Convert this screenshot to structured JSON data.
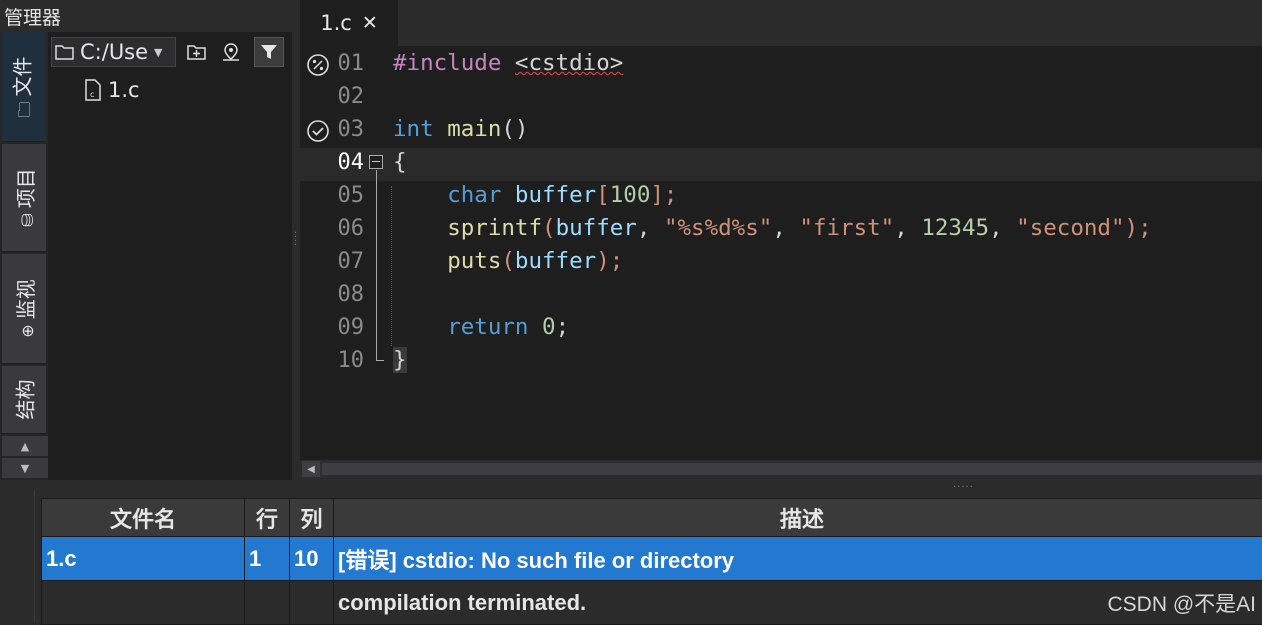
{
  "manager": {
    "title": "管理器",
    "side_tabs": [
      "文件",
      "项目",
      "监视",
      "结构"
    ],
    "path": "C:/Use",
    "tree": [
      {
        "name": "1.c"
      }
    ]
  },
  "editor": {
    "tabs": [
      {
        "label": "1.c",
        "close": "✕"
      }
    ],
    "current_line": "04",
    "lines": [
      {
        "n": "01",
        "icon": "breakpoint-percent"
      },
      {
        "n": "02"
      },
      {
        "n": "03",
        "icon": "check"
      },
      {
        "n": "04"
      },
      {
        "n": "05"
      },
      {
        "n": "06"
      },
      {
        "n": "07"
      },
      {
        "n": "08"
      },
      {
        "n": "09"
      },
      {
        "n": "10"
      }
    ],
    "code": {
      "l1_directive": "#include",
      "l1_header": "<cstdio>",
      "l3_type": "int",
      "l3_name": "main",
      "l3_parens": "()",
      "l4": "{",
      "l5_type": "char",
      "l5_var": "buffer",
      "l5_open": "[",
      "l5_num": "100",
      "l5_close": "];",
      "l6_fn": "sprintf",
      "l6_p1": "(",
      "l6_var": "buffer",
      "l6_c1": ", ",
      "l6_s1": "\"%s%d%s\"",
      "l6_c2": ", ",
      "l6_s2": "\"first\"",
      "l6_c3": ", ",
      "l6_num": "12345",
      "l6_c4": ", ",
      "l6_s3": "\"second\"",
      "l6_end": ");",
      "l7_fn": "puts",
      "l7_p1": "(",
      "l7_var": "buffer",
      "l7_end": ");",
      "l9_kw": "return",
      "l9_num": "0",
      "l9_end": ";",
      "l10": "}"
    }
  },
  "messages": {
    "headers": {
      "file": "文件名",
      "line": "行",
      "col": "列",
      "desc": "描述"
    },
    "rows": [
      {
        "file": "1.c",
        "line": "1",
        "col": "10",
        "desc": "[错误] cstdio: No such file or directory",
        "selected": true
      },
      {
        "file": "",
        "line": "",
        "col": "",
        "desc": "compilation terminated.",
        "selected": false
      }
    ]
  },
  "watermark": "CSDN @不是AI",
  "colors": {
    "selection": "#2378d0",
    "keyword": "#569cd6",
    "string": "#ce9178",
    "number": "#b5cea8",
    "function": "#dcdcaa"
  }
}
